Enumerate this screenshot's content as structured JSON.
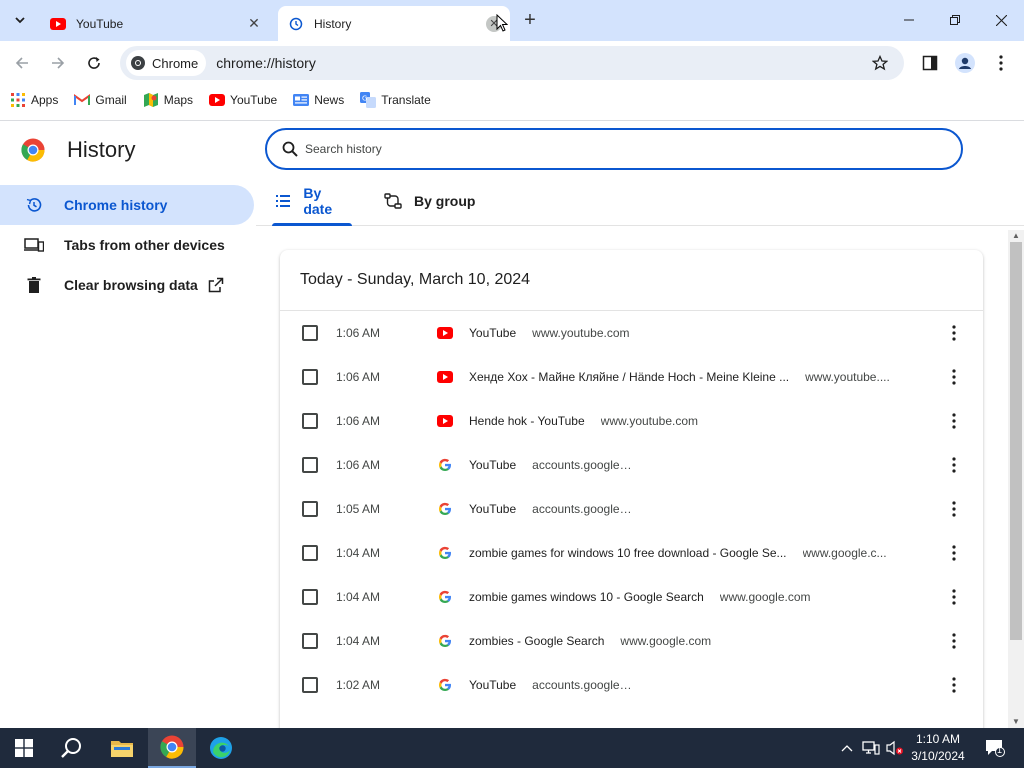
{
  "browser": {
    "tabs": [
      {
        "title": "YouTube",
        "favicon": "youtube-icon",
        "active": false
      },
      {
        "title": "History",
        "favicon": "history-icon",
        "active": true
      }
    ],
    "chip_label": "Chrome",
    "url": "chrome://history",
    "bookmarks": [
      {
        "label": "Apps",
        "icon": "apps-grid-icon"
      },
      {
        "label": "Gmail",
        "icon": "gmail-icon"
      },
      {
        "label": "Maps",
        "icon": "maps-icon"
      },
      {
        "label": "YouTube",
        "icon": "youtube-icon"
      },
      {
        "label": "News",
        "icon": "news-icon"
      },
      {
        "label": "Translate",
        "icon": "translate-icon"
      }
    ]
  },
  "page": {
    "title": "History",
    "search_placeholder": "Search history",
    "nav": [
      {
        "label": "Chrome history",
        "icon": "history-icon",
        "active": true
      },
      {
        "label": "Tabs from other devices",
        "icon": "devices-icon",
        "active": false
      },
      {
        "label": "Clear browsing data",
        "icon": "trash-icon",
        "active": false
      }
    ],
    "view_tabs": [
      {
        "label": "By date",
        "active": true
      },
      {
        "label": "By group",
        "active": false
      }
    ],
    "day_header": "Today - Sunday, March 10, 2024",
    "entries": [
      {
        "time": "1:06 AM",
        "title": "YouTube",
        "domain": "www.youtube.com",
        "favicon": "youtube-icon"
      },
      {
        "time": "1:06 AM",
        "title": "Хенде Хох - Майне Кляйне / Hände Hoch - Meine Kleine ...",
        "domain": "www.youtube....",
        "favicon": "youtube-icon"
      },
      {
        "time": "1:06 AM",
        "title": "Hende hok - YouTube",
        "domain": "www.youtube.com",
        "favicon": "youtube-icon"
      },
      {
        "time": "1:06 AM",
        "title": "YouTube",
        "domain": "accounts.google.com",
        "favicon": "google-icon"
      },
      {
        "time": "1:05 AM",
        "title": "YouTube",
        "domain": "accounts.google.com",
        "favicon": "google-icon"
      },
      {
        "time": "1:04 AM",
        "title": "zombie games for windows 10 free download - Google Se...",
        "domain": "www.google.c...",
        "favicon": "google-icon"
      },
      {
        "time": "1:04 AM",
        "title": "zombie games windows 10 - Google Search",
        "domain": "www.google.com",
        "favicon": "google-icon"
      },
      {
        "time": "1:04 AM",
        "title": "zombies - Google Search",
        "domain": "www.google.com",
        "favicon": "google-icon"
      },
      {
        "time": "1:02 AM",
        "title": "YouTube",
        "domain": "accounts.google.com",
        "favicon": "google-icon"
      }
    ]
  },
  "taskbar": {
    "time": "1:10 AM",
    "date": "3/10/2024",
    "notification_count": "1"
  },
  "colors": {
    "accent": "#0b57d0",
    "titlebar": "#d3e3fd",
    "youtube_red": "#ff0000",
    "taskbar": "#1f2a3c"
  }
}
